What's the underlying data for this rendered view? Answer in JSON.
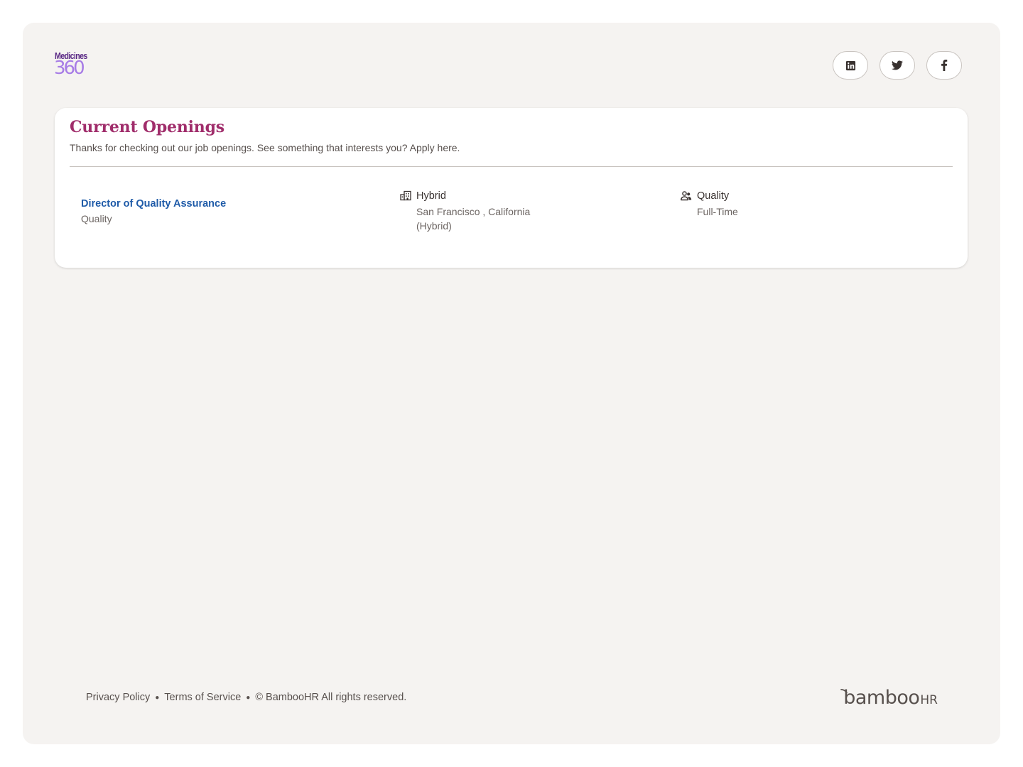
{
  "brand": {
    "logo_top": "Medicines",
    "logo_num": "360"
  },
  "social": [
    {
      "name": "linkedin",
      "icon": "linkedin-icon"
    },
    {
      "name": "twitter",
      "icon": "twitter-icon"
    },
    {
      "name": "facebook",
      "icon": "facebook-icon"
    }
  ],
  "openings": {
    "title": "Current Openings",
    "subtitle": "Thanks for checking out our job openings. See something that interests you? Apply here.",
    "jobs": [
      {
        "title": "Director of Quality Assurance",
        "department": "Quality",
        "location_type": "Hybrid",
        "location": "San Francisco , California",
        "location_note": "(Hybrid)",
        "team": "Quality",
        "employment_type": "Full-Time"
      }
    ]
  },
  "footer": {
    "privacy": "Privacy Policy",
    "terms": "Terms of Service",
    "copyright": "© BambooHR All rights reserved.",
    "bamboo_main": "bamboo",
    "bamboo_hr": "HR"
  },
  "colors": {
    "title": "#a02d6b",
    "link": "#1f5ba8",
    "page_bg": "#f5f3f1",
    "logo_purple": "#5b2a86",
    "logo_lavender": "#a77ce6"
  }
}
